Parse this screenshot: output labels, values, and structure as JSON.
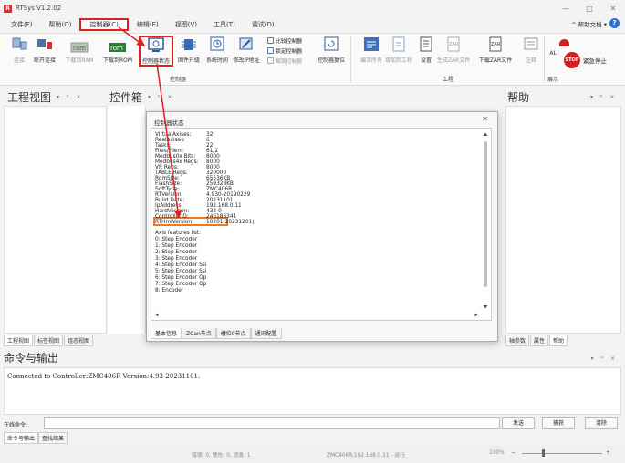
{
  "app": {
    "logo": "R",
    "title": "RTSys V1.2.02"
  },
  "window_controls": [
    "—",
    "□",
    "✕"
  ],
  "menu": {
    "items": [
      "文件(F)",
      "帮助(O)",
      "控制器(C)",
      "编辑(E)",
      "视图(V)",
      "工具(T)",
      "调试(D)"
    ],
    "right_label": "^ 帮助文档 ▾",
    "help_glyph": "?"
  },
  "ribbon": {
    "controller": {
      "connect": "连接",
      "disconnect": "断开连接",
      "download_ram": "下载到RAM",
      "download_rom": "下载到ROM",
      "controller_status": "控制器状态",
      "firmware_upgrade": "固件升级",
      "system_time": "系统时间",
      "modify_ip": "修改IP地址",
      "compare": "比较控制器",
      "lock": "锁定控制器",
      "unlock": "解锁控制器",
      "reset": "控制器复位",
      "group_label": "控制器"
    },
    "project": {
      "compile_all": "编译所有",
      "add_to_project": "增加到工程",
      "settings": "设置",
      "gen_zar": "生成ZAR文件",
      "download_zar": "下载ZAR文件",
      "comment": "注释",
      "group_label": "工程"
    },
    "alarm_prefix": "ALI",
    "show_label": "展示",
    "stop_icon_text": "STOP",
    "emergency_stop": "紧急停止"
  },
  "panes": {
    "project_view": "工程视图",
    "toolbox": "控件箱",
    "help": "帮助",
    "pins": "▾ ᵖ ×"
  },
  "left_tabs": [
    "工程视图",
    "标签视图",
    "组态视图"
  ],
  "right_tabs": [
    "轴参数",
    "属性",
    "帮助"
  ],
  "dialog": {
    "title": "控制器状态",
    "close": "✕",
    "info": [
      {
        "k": "VirtualAxises:",
        "v": "32"
      },
      {
        "k": "RealAxises:",
        "v": "6"
      },
      {
        "k": "Tasks:",
        "v": "22"
      },
      {
        "k": "Files/Filem:",
        "v": "61/2"
      },
      {
        "k": "Modbus0x Bits:",
        "v": "8000"
      },
      {
        "k": "Modbus4x Regs:",
        "v": "8000"
      },
      {
        "k": "VR Regs:",
        "v": "8000"
      },
      {
        "k": "TABLE Regs:",
        "v": "320000"
      },
      {
        "k": "RomSize:",
        "v": "65536KB"
      },
      {
        "k": "FlashSize:",
        "v": "259328KB"
      },
      {
        "k": "SoftType:",
        "v": "ZMC406R"
      },
      {
        "k": "RTVersion:",
        "v": "4.930-20190229"
      },
      {
        "k": "Build Date:",
        "v": "20231101"
      },
      {
        "k": "IpAddress:",
        "v": "192.168.0.11"
      },
      {
        "k": "HardVersion:",
        "v": "432-0"
      },
      {
        "k": "ControllerID:",
        "v": "246186341"
      },
      {
        "k": "RTHmiVersion:",
        "v": "10201(20231201)"
      }
    ],
    "axis_heading": "Axis features list:",
    "axes": [
      "0: Step Encoder",
      "1: Step Encoder",
      "2: Step Encoder",
      "3: Step Encoder",
      "4: Step Encoder Ssi",
      "5: Step Encoder Ssi",
      "6: Step Encoder Op",
      "7: Step Encoder Op",
      "8: Encoder"
    ],
    "tabs": [
      "基本信息",
      "ZCan节点",
      "槽位0节点",
      "通讯配置"
    ]
  },
  "command": {
    "title": "命令与输出",
    "output": "Connected to Controller:ZMC406R Version:4.93-20231101.",
    "input_label": "在线命令:",
    "send": "发送",
    "capture": "捕获",
    "clear": "清除",
    "tabs": [
      "命令与输出",
      "查找结果"
    ]
  },
  "status": {
    "messages": "错误: 0, 警告: 0, 消息: 1",
    "connection": "ZMC406R:192.168.0.11 - 运行",
    "zoom": "100%"
  }
}
